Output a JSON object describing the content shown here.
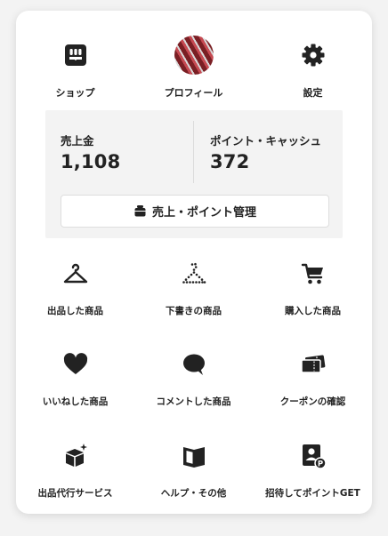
{
  "top_nav": [
    {
      "label": "ショップ",
      "icon": "shop-icon"
    },
    {
      "label": "プロフィール",
      "icon": "avatar"
    },
    {
      "label": "設定",
      "icon": "gear-icon"
    }
  ],
  "sales": {
    "sales_label": "売上金",
    "sales_value": "1,108",
    "points_label": "ポイント・キャッシュ",
    "points_value": "372",
    "manage_label": "売上・ポイント管理"
  },
  "grid": [
    {
      "label": "出品した商品",
      "icon": "hanger-icon"
    },
    {
      "label": "下書きの商品",
      "icon": "dotted-hanger-icon"
    },
    {
      "label": "購入した商品",
      "icon": "cart-icon"
    },
    {
      "label": "いいねした商品",
      "icon": "heart-icon"
    },
    {
      "label": "コメントした商品",
      "icon": "comment-icon"
    },
    {
      "label": "クーポンの確認",
      "icon": "coupon-icon"
    },
    {
      "label": "出品代行サービス",
      "icon": "box-sparkle-icon"
    },
    {
      "label": "ヘルプ・その他",
      "icon": "book-icon"
    },
    {
      "label": "招待してポイントGET",
      "icon": "invite-icon"
    }
  ]
}
